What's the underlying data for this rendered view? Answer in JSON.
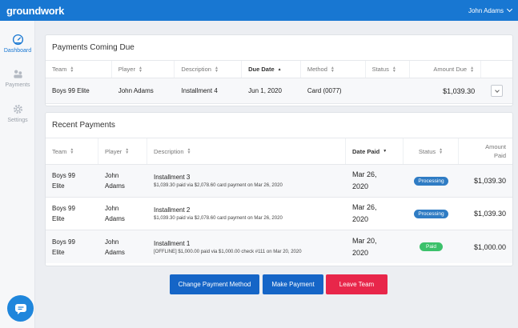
{
  "app": {
    "brand": "groundwork",
    "user_name": "John Adams"
  },
  "sidebar": {
    "items": [
      {
        "label": "Dashboard",
        "icon": "dashboard-icon",
        "active": true
      },
      {
        "label": "Payments",
        "icon": "payments-icon",
        "active": false
      },
      {
        "label": "Settings",
        "icon": "gear-icon",
        "active": false
      }
    ]
  },
  "due": {
    "title": "Payments Coming Due",
    "columns": [
      "Team",
      "Player",
      "Description",
      "Due Date",
      "Method",
      "Status",
      "Amount Due"
    ],
    "sorted_column": "Due Date",
    "rows": [
      {
        "team": "Boys 99 Elite",
        "player": "John Adams",
        "description": "Installment 4",
        "due_date": "Jun 1, 2020",
        "method": "Card (0077)",
        "status": "",
        "amount": "$1,039.30"
      }
    ]
  },
  "recent": {
    "title": "Recent Payments",
    "columns": [
      "Team",
      "Player",
      "Description",
      "Date Paid",
      "Status",
      "Amount Paid"
    ],
    "sorted_column": "Date Paid",
    "rows": [
      {
        "team_1": "Boys 99",
        "team_2": "Elite",
        "player_1": "John",
        "player_2": "Adams",
        "title": "Installment 3",
        "detail": "$1,039.30 paid via $2,078.60 card payment on Mar 26, 2020",
        "date_1": "Mar 26,",
        "date_2": "2020",
        "status": "Processing",
        "amount": "$1,039.30"
      },
      {
        "team_1": "Boys 99",
        "team_2": "Elite",
        "player_1": "John",
        "player_2": "Adams",
        "title": "Installment 2",
        "detail": "$1,039.30 paid via $2,078.60 card payment on Mar 26, 2020",
        "date_1": "Mar 26,",
        "date_2": "2020",
        "status": "Processing",
        "amount": "$1,039.30"
      },
      {
        "team_1": "Boys 99",
        "team_2": "Elite",
        "player_1": "John",
        "player_2": "Adams",
        "title": "Installment 1",
        "detail": "[OFFLINE] $1,000.00 paid via $1,000.00 check #111 on Mar 20, 2020",
        "date_1": "Mar 20,",
        "date_2": "2020",
        "status": "Paid",
        "amount": "$1,000.00"
      }
    ]
  },
  "actions": {
    "change_method": "Change Payment Method",
    "make_payment": "Make Payment",
    "leave_team": "Leave Team"
  },
  "colors": {
    "primary": "#1877d2",
    "button_blue": "#1565c7",
    "danger": "#e8264a",
    "processing": "#2f7cc4",
    "paid": "#3cc16b"
  },
  "chat": {
    "icon": "chat-icon"
  }
}
